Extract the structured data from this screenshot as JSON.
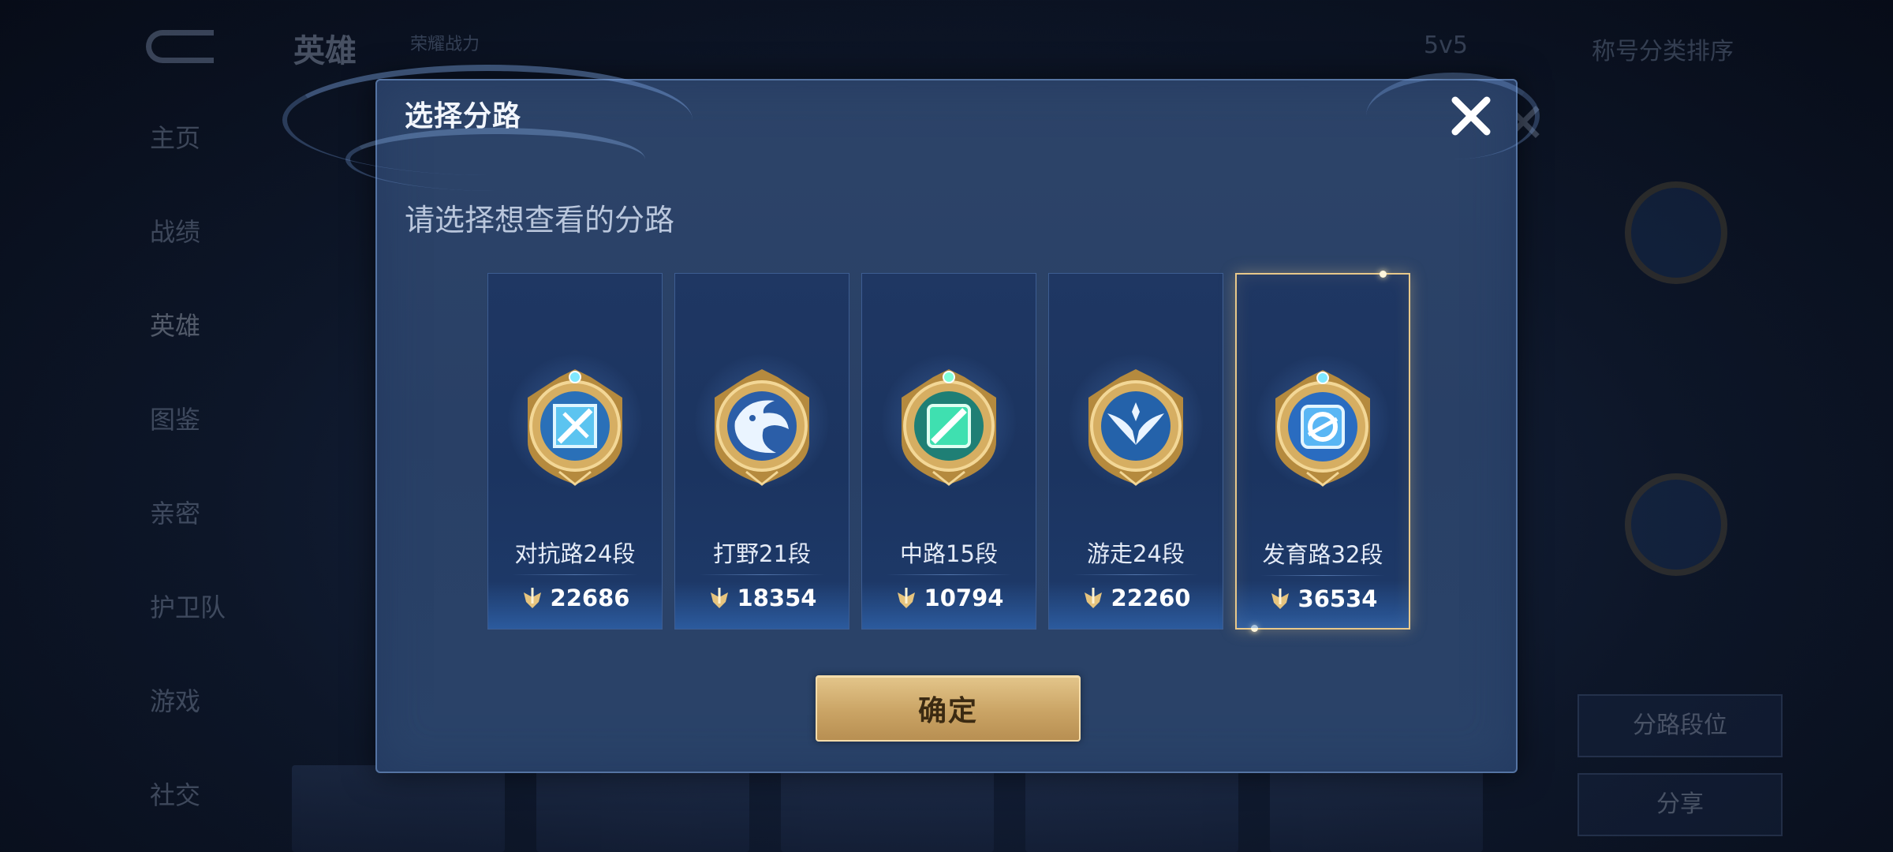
{
  "background": {
    "title": "英雄",
    "stat_text": "荣耀战力",
    "mode": "5v5",
    "sort": "称号分类排序",
    "nav_items": [
      "主页",
      "战绩",
      "英雄",
      "图鉴",
      "亲密",
      "护卫队",
      "游戏",
      "社交"
    ],
    "right_button_1": "分路段位",
    "right_button_2": "分享"
  },
  "dialog": {
    "title": "选择分路",
    "subtitle": "请选择想查看的分路",
    "close_icon": "close-icon",
    "confirm_label": "确定"
  },
  "lanes": [
    {
      "label": "对抗路24段",
      "score": "22686",
      "icon": "clash-lane-icon",
      "selected": false
    },
    {
      "label": "打野21段",
      "score": "18354",
      "icon": "jungle-icon",
      "selected": false
    },
    {
      "label": "中路15段",
      "score": "10794",
      "icon": "mid-lane-icon",
      "selected": false
    },
    {
      "label": "游走24段",
      "score": "22260",
      "icon": "roam-icon",
      "selected": false
    },
    {
      "label": "发育路32段",
      "score": "36534",
      "icon": "farm-lane-icon",
      "selected": true
    }
  ],
  "colors": {
    "accent_gold": "#e8c88a",
    "dialog_bg": "#2d4469",
    "card_bg": "#1f3763",
    "confirm_text": "#3b2a12"
  }
}
